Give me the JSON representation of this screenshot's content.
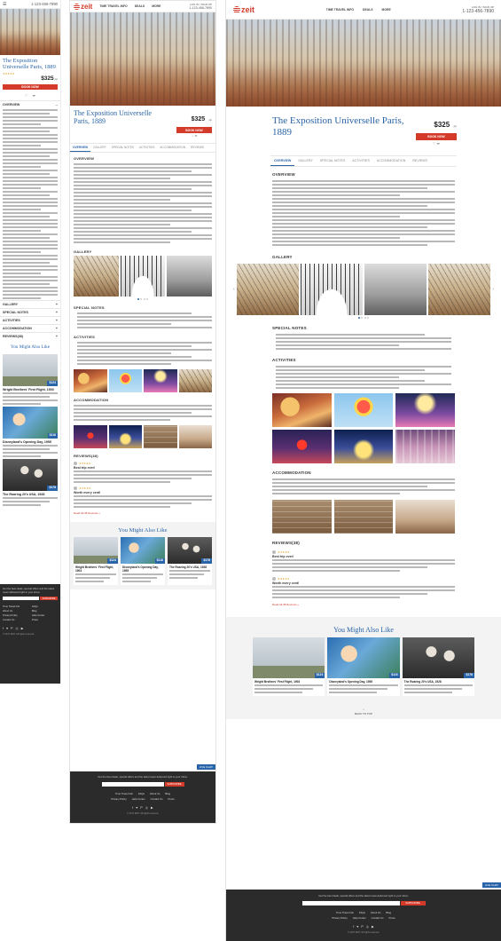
{
  "header": {
    "phone": "1-123-456-7890",
    "brand": "zeit",
    "nav": [
      "TIME TRAVEL INFO",
      "DEALS",
      "MORE"
    ],
    "login": "LOG IN / SIGN UP"
  },
  "tour": {
    "title": "The Exposition Universelle Paris, 1889",
    "price": "$325",
    "price_suffix": "pp",
    "book_label": "BOOK NOW"
  },
  "tabs": [
    "OVERVIEW",
    "GALLERY",
    "SPECIAL NOTES",
    "ACTIVITIES",
    "ACCOMMODATION",
    "REVIEWS"
  ],
  "sections": {
    "overview": "OVERVIEW",
    "gallery": "GALLERY",
    "special_notes": "SPECIAL NOTES",
    "activities": "ACTIVITIES",
    "accommodation": "ACCOMMODATION",
    "reviews": "REVIEWS(38)"
  },
  "reviews": [
    {
      "title": "Best trip ever!"
    },
    {
      "title": "Worth every cent!"
    }
  ],
  "read_all": "Read All 38 Reviews »",
  "you_might_also_like": {
    "heading": "You Might Also Like",
    "cards": [
      {
        "title": "Wright Brothers' First Flight, 1903",
        "price": "$124",
        "icon": "plane-photo"
      },
      {
        "title": "Disneyland's Opening Day, 1955",
        "price": "$116",
        "icon": "disney-photo"
      },
      {
        "title": "The Roaring 20's USA, 1928",
        "price": "$178",
        "icon": "roaring-photo"
      }
    ]
  },
  "live_chat": "LIVE CHAT",
  "back_to_top": "BACK TO TOP",
  "footer": {
    "newsletter": "Get the best deals, special offers and the latest news delivered right to your inbox.",
    "subscribe": "SUBSCRIBE",
    "links": [
      "Time Travel Info",
      "FAQs",
      "About Us",
      "Blog",
      "Privacy Policy",
      "Help Center",
      "Contact Us",
      "Press"
    ],
    "social": [
      "f",
      "♥",
      "P",
      "◎",
      "▶"
    ],
    "copyright": "© 2017 ZEIT. All rights reserved."
  },
  "colors": {
    "brand_red": "#d43a2a",
    "accent_blue": "#2a64a8",
    "footer_bg": "#2b2b2b"
  }
}
